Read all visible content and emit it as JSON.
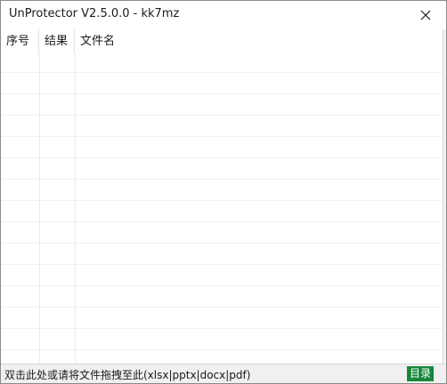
{
  "window": {
    "title": "UnProtector V2.5.0.0 - kk7mz"
  },
  "icons": {
    "close": "close-icon"
  },
  "table": {
    "columns": [
      "序号",
      "结果",
      "文件名"
    ],
    "rows": []
  },
  "statusbar": {
    "hint": "双击此处或请将文件拖拽至此(xlsx|pptx|docx|pdf)",
    "dir_button": "目录"
  },
  "colors": {
    "accent_green": "#16883a",
    "status_bg": "#f0f0f0"
  }
}
